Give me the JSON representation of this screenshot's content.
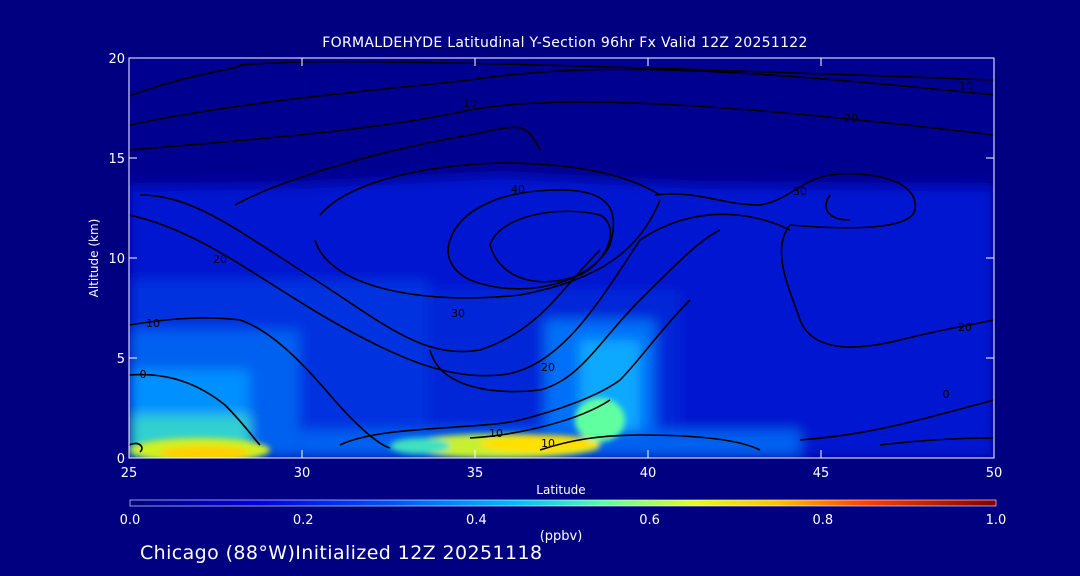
{
  "chart_data": {
    "type": "heatmap",
    "title": "FORMALDEHYDE Latitudinal Y-Section 96hr  Fx Valid 12Z 20251122",
    "xlabel": "Latitude",
    "ylabel": "Altitude (km)",
    "xlim": [
      25,
      50
    ],
    "ylim": [
      0,
      20
    ],
    "x_ticks": [
      "25",
      "30",
      "35",
      "40",
      "45",
      "50"
    ],
    "y_ticks": [
      "0",
      "5",
      "10",
      "15",
      "20"
    ],
    "colorbar": {
      "label": "(ppbv)",
      "range": [
        0.0,
        1.0
      ],
      "ticks": [
        "0.0",
        "0.2",
        "0.4",
        "0.6",
        "0.8",
        "1.0"
      ]
    },
    "contour_labels": [
      "0",
      "10",
      "20",
      "30",
      "40",
      "10",
      "20",
      "30",
      "10",
      "20",
      "10",
      "0",
      "10",
      "20"
    ],
    "grid": false
  },
  "footer": "Chicago (88°W)Initialized 12Z 20251118"
}
